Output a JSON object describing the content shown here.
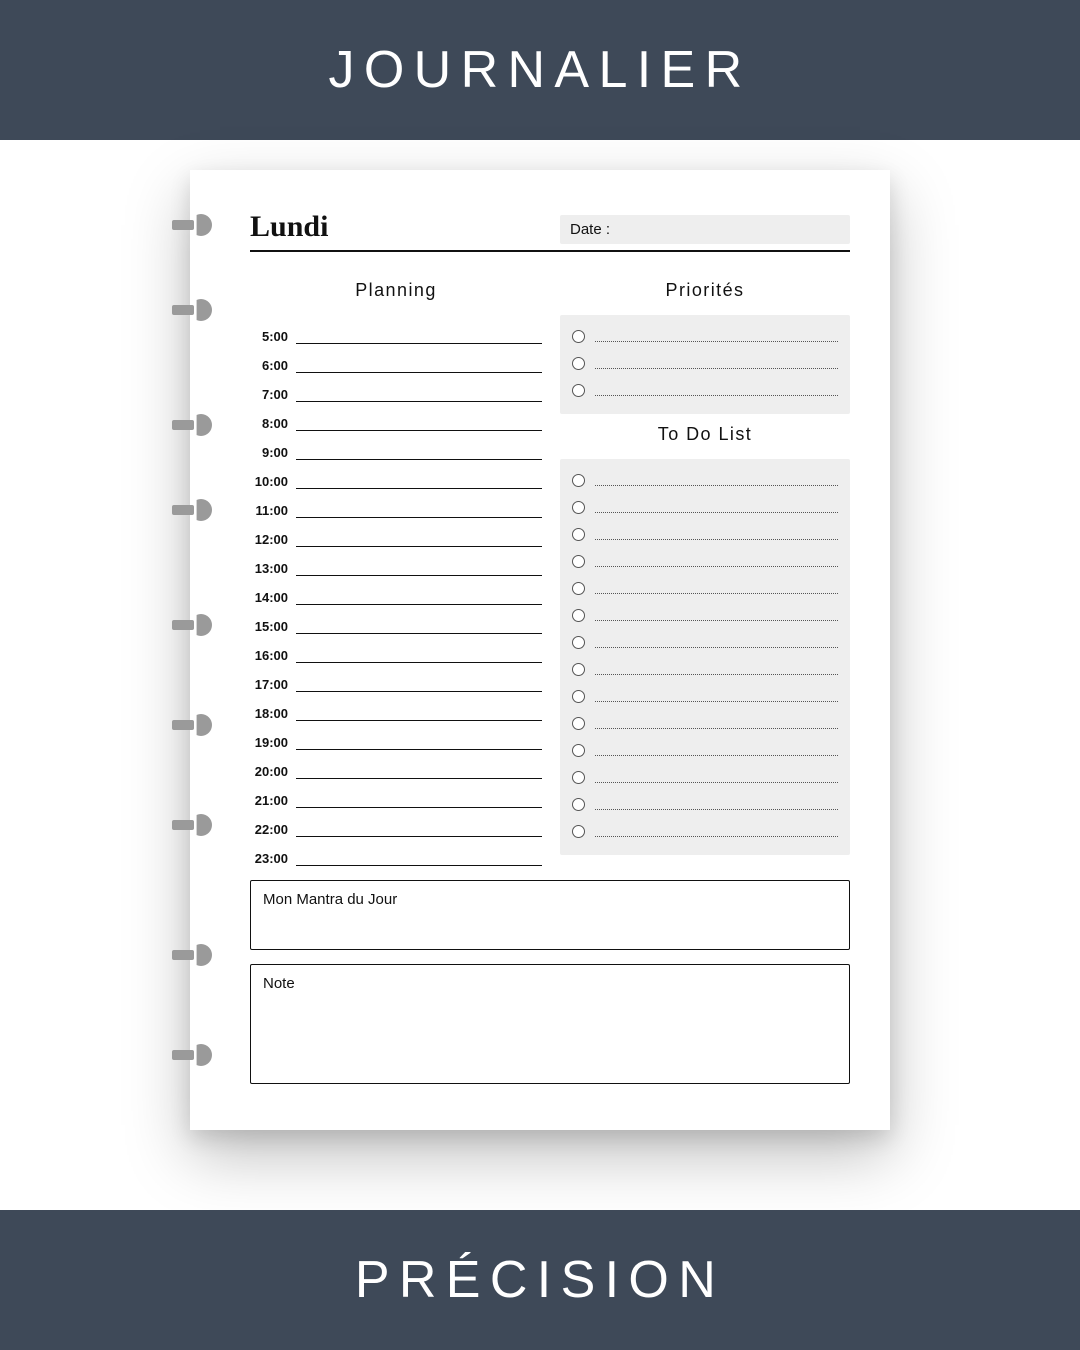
{
  "header_band": "JOURNALIER",
  "footer_band": "PRÉCISION",
  "page": {
    "day": "Lundi",
    "date_label": "Date :",
    "planning_title": "Planning",
    "priorities_title": "Priorités",
    "todo_title": "To Do List",
    "mantra_label": "Mon Mantra du Jour",
    "note_label": "Note",
    "hours": [
      "5:00",
      "6:00",
      "7:00",
      "8:00",
      "9:00",
      "10:00",
      "11:00",
      "12:00",
      "13:00",
      "14:00",
      "15:00",
      "16:00",
      "17:00",
      "18:00",
      "19:00",
      "20:00",
      "21:00",
      "22:00",
      "23:00"
    ],
    "priorities_count": 3,
    "todo_count": 14,
    "disc_positions": [
      55,
      140,
      255,
      340,
      455,
      555,
      655,
      785,
      885
    ]
  },
  "colors": {
    "band": "#3e4958",
    "sheet_bg": "#ffffff",
    "panel_bg": "#eeeeee",
    "disc": "#9a9a9a",
    "ink": "#111111"
  }
}
